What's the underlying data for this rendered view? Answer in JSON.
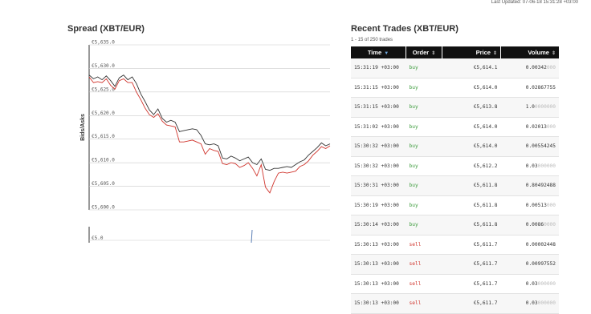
{
  "header": {
    "last_updated": "Last Updated: 07-06-18 15:31:28 +03:00"
  },
  "spread_panel": {
    "title": "Spread (XBT/EUR)",
    "ylabel": "Bids/Asks",
    "y_ticks": [
      "€5,635.0",
      "€5,630.0",
      "€5,625.0",
      "€5,620.0",
      "€5,615.0",
      "€5,610.0",
      "€5,605.0",
      "€5,600.0"
    ],
    "lower_chart_tick": "€5.0"
  },
  "trades_panel": {
    "title": "Recent Trades (XBT/EUR)",
    "subtitle": "1 - 15 of 250 trades",
    "columns": [
      "Time",
      "Order",
      "Price",
      "Volume"
    ],
    "rows": [
      {
        "time": "15:31:19 +03:00",
        "order": "buy",
        "price": "€5,614.1",
        "vol": "0.00342",
        "vol_pad": "000"
      },
      {
        "time": "15:31:15 +03:00",
        "order": "buy",
        "price": "€5,614.0",
        "vol": "0.02867755",
        "vol_pad": ""
      },
      {
        "time": "15:31:15 +03:00",
        "order": "buy",
        "price": "€5,613.8",
        "vol": "1.0",
        "vol_pad": "0000000"
      },
      {
        "time": "15:31:02 +03:00",
        "order": "buy",
        "price": "€5,614.0",
        "vol": "0.02013",
        "vol_pad": "000"
      },
      {
        "time": "15:30:32 +03:00",
        "order": "buy",
        "price": "€5,614.0",
        "vol": "0.00554245",
        "vol_pad": ""
      },
      {
        "time": "15:30:32 +03:00",
        "order": "buy",
        "price": "€5,612.2",
        "vol": "0.03",
        "vol_pad": "000000"
      },
      {
        "time": "15:30:31 +03:00",
        "order": "buy",
        "price": "€5,611.8",
        "vol": "0.80492488",
        "vol_pad": ""
      },
      {
        "time": "15:30:19 +03:00",
        "order": "buy",
        "price": "€5,611.8",
        "vol": "0.00513",
        "vol_pad": "000"
      },
      {
        "time": "15:30:14 +03:00",
        "order": "buy",
        "price": "€5,611.8",
        "vol": "0.0086",
        "vol_pad": "0000"
      },
      {
        "time": "15:30:13 +03:00",
        "order": "sell",
        "price": "€5,611.7",
        "vol": "0.00002448",
        "vol_pad": ""
      },
      {
        "time": "15:30:13 +03:00",
        "order": "sell",
        "price": "€5,611.7",
        "vol": "0.00997552",
        "vol_pad": ""
      },
      {
        "time": "15:30:13 +03:00",
        "order": "sell",
        "price": "€5,611.7",
        "vol": "0.03",
        "vol_pad": "000000"
      },
      {
        "time": "15:30:13 +03:00",
        "order": "sell",
        "price": "€5,611.7",
        "vol": "0.03",
        "vol_pad": "000000"
      }
    ]
  },
  "colors": {
    "bid_line": "#333333",
    "ask_line": "#d0342c",
    "buy": "#3c9c3c",
    "sell": "#d0342c",
    "header_bg": "#111111"
  },
  "chart_data": {
    "type": "line",
    "title": "",
    "xlabel": "",
    "ylabel": "Bids/Asks",
    "ylim": [
      5600,
      5635
    ],
    "grid": true,
    "series": [
      {
        "values": [
          5628.6,
          5627.8,
          5628.2,
          5627.6,
          5628.4,
          5627.4,
          5626.2,
          5628.0,
          5628.6,
          5627.6,
          5628.2,
          5626.8,
          5624.6,
          5623.0,
          5621.2,
          5620.2,
          5621.4,
          5619.4,
          5618.6,
          5619.0,
          5618.6,
          5616.6,
          5616.8,
          5617.0,
          5617.2,
          5617.0,
          5615.8,
          5614.0,
          5613.8,
          5614.0,
          5613.6,
          5611.0,
          5610.8,
          5611.4,
          5611.0,
          5610.4,
          5610.8,
          5611.2,
          5610.0,
          5609.6,
          5610.8,
          5608.6,
          5608.4,
          5608.8,
          5608.8,
          5609.0,
          5609.2,
          5609.0,
          5609.6,
          5610.2,
          5610.6,
          5611.6,
          5612.4,
          5613.2,
          5614.2,
          5613.6,
          5614.0
        ]
      },
      {
        "values": [
          5628.2,
          5627.0,
          5627.2,
          5627.0,
          5627.8,
          5626.4,
          5625.6,
          5627.4,
          5627.8,
          5627.0,
          5627.0,
          5625.0,
          5623.4,
          5621.6,
          5620.2,
          5619.6,
          5620.4,
          5618.8,
          5618.0,
          5617.8,
          5617.6,
          5614.4,
          5614.4,
          5614.6,
          5614.8,
          5614.4,
          5614.0,
          5611.8,
          5613.0,
          5612.6,
          5612.4,
          5609.8,
          5609.6,
          5610.0,
          5609.8,
          5609.0,
          5609.4,
          5610.0,
          5608.8,
          5607.2,
          5609.6,
          5604.8,
          5603.6,
          5606.0,
          5607.8,
          5608.0,
          5607.8,
          5608.0,
          5608.2,
          5609.2,
          5609.6,
          5610.4,
          5611.6,
          5612.4,
          5613.4,
          5613.0,
          5613.6
        ]
      }
    ]
  }
}
